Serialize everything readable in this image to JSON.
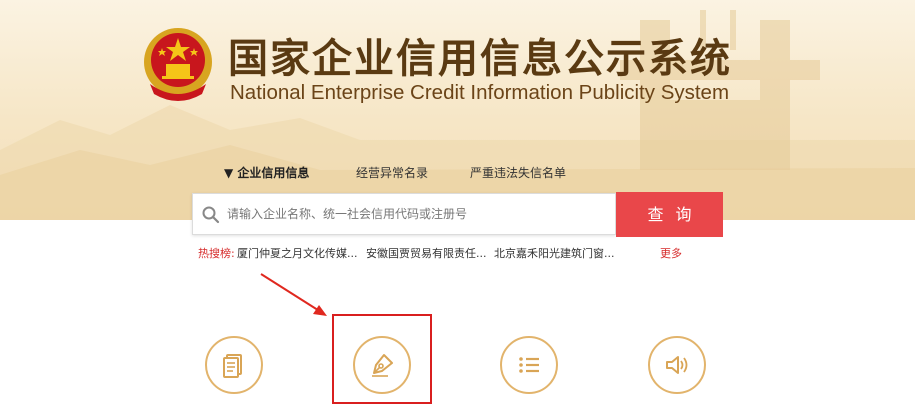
{
  "header": {
    "title_cn": "国家企业信用信息公示系统",
    "title_en": "National Enterprise Credit Information Publicity System",
    "emblem_icon": "national-emblem-icon"
  },
  "nav": {
    "items": [
      {
        "label": "▼ 企业信用信息",
        "active": true
      },
      {
        "label": "经营异常名录",
        "active": false
      },
      {
        "label": "严重违法失信名单",
        "active": false
      }
    ]
  },
  "search": {
    "placeholder": "请输入企业名称、统一社会信用代码或注册号",
    "button_label": "查询"
  },
  "hot_search": {
    "label": "热搜榜:",
    "items": [
      "厦门仲夏之月文化传媒...",
      "安徽国贾贸易有限责任...",
      "北京嘉禾阳光建筑门窗..."
    ],
    "more_label": "更多"
  },
  "features": {
    "icons": [
      "document-icon",
      "pen-nib-icon",
      "list-icon",
      "speaker-icon"
    ]
  },
  "colors": {
    "accent_red": "#e9474a",
    "title_brown": "#5a3a12",
    "gold": "#e2b46c",
    "highlight_red": "#d91f1f"
  }
}
